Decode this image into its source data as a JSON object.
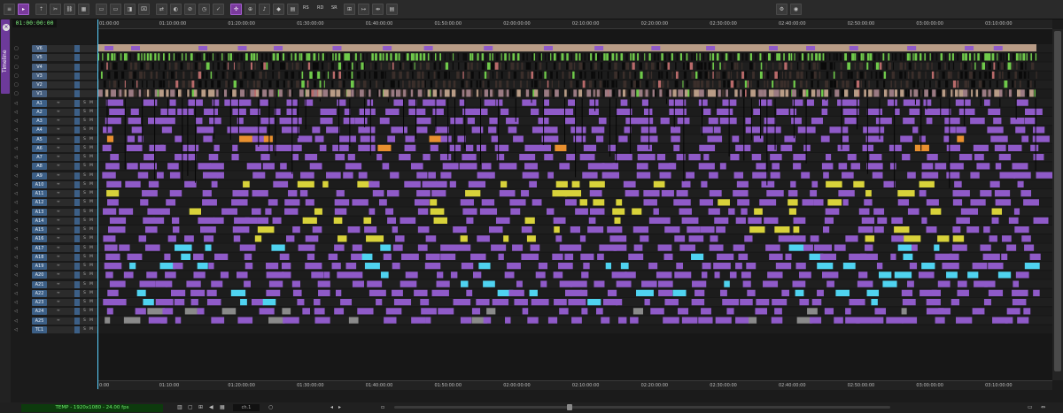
{
  "app": {
    "tab_label": "Timeline",
    "close_glyph": "×",
    "timecode": "01:00:00:00"
  },
  "toolbar": {
    "buttons": [
      {
        "id": "menu",
        "icon": "menu-icon",
        "glyph": "≡"
      },
      {
        "id": "segment-select",
        "icon": "segment-select-icon",
        "glyph": "▸",
        "active": true
      },
      {
        "id": "lift",
        "icon": "lift-icon",
        "glyph": "⇡"
      },
      {
        "id": "cut",
        "icon": "scissors-icon",
        "glyph": "✂"
      },
      {
        "id": "link",
        "icon": "link-icon",
        "glyph": "⛓"
      },
      {
        "id": "grid",
        "icon": "grid-icon",
        "glyph": "▦"
      },
      {
        "id": "overwrite",
        "icon": "overwrite-icon",
        "glyph": "▭"
      },
      {
        "id": "splice",
        "icon": "splice-icon",
        "glyph": "▭"
      },
      {
        "id": "trim",
        "icon": "trim-icon",
        "glyph": "◨"
      },
      {
        "id": "extract",
        "icon": "extract-icon",
        "glyph": "⌧"
      },
      {
        "id": "replace",
        "icon": "replace-icon",
        "glyph": "⇄"
      },
      {
        "id": "effect",
        "icon": "effect-icon",
        "glyph": "◐"
      },
      {
        "id": "no",
        "icon": "disable-icon",
        "glyph": "⊘"
      },
      {
        "id": "clock",
        "icon": "clock-icon",
        "glyph": "◷"
      },
      {
        "id": "check",
        "icon": "check-icon",
        "glyph": "✓"
      },
      {
        "id": "sync",
        "icon": "sync-icon",
        "glyph": "✣",
        "active": true
      },
      {
        "id": "add-edit",
        "icon": "add-edit-icon",
        "glyph": "⊕"
      },
      {
        "id": "audio",
        "icon": "audio-icon",
        "glyph": "♪"
      },
      {
        "id": "keyframe",
        "icon": "keyframe-icon",
        "glyph": "◆"
      },
      {
        "id": "mute",
        "icon": "mute-icon",
        "glyph": "▤"
      }
    ],
    "text_buttons": [
      "RS",
      "RD",
      "SR"
    ],
    "more_buttons": [
      {
        "id": "fx1",
        "icon": "effect-mode-icon",
        "glyph": "⊞"
      },
      {
        "id": "fx2",
        "icon": "trim-mode-icon",
        "glyph": "↦"
      },
      {
        "id": "fx3",
        "icon": "split-icon",
        "glyph": "⇹"
      },
      {
        "id": "fx4",
        "icon": "render-icon",
        "glyph": "▤"
      }
    ],
    "right_buttons": [
      {
        "id": "settings",
        "icon": "gear-icon",
        "glyph": "⚙"
      },
      {
        "id": "status",
        "icon": "status-icon",
        "glyph": "◉"
      }
    ]
  },
  "ruler": {
    "ticks": [
      "01:00:00",
      "01:10:00:00",
      "01:20:00:00",
      "01:30:00:00",
      "01:40:00:00",
      "01:50:00:00",
      "02:00:00:00",
      "02:10:00:00",
      "02:20:00:00",
      "02:30:00:00",
      "02:40:00:00",
      "02:50:00:00",
      "03:00:00:00",
      "03:10:00:00"
    ],
    "bottom_ticks": [
      "0:00",
      "01:10:00",
      "01:20:00:00",
      "01:30:00:00",
      "01:40:00:00",
      "01:50:00:00",
      "02:00:00:00",
      "02:10:00:00",
      "02:20:00:00",
      "02:30:00:00",
      "02:40:00:00",
      "02:50:00:00",
      "03:00:00:00",
      "03:10:00:00"
    ]
  },
  "tracks": [
    {
      "name": "V6",
      "kind": "video"
    },
    {
      "name": "V5",
      "kind": "video"
    },
    {
      "name": "V4",
      "kind": "video"
    },
    {
      "name": "V3",
      "kind": "video"
    },
    {
      "name": "V2",
      "kind": "video"
    },
    {
      "name": "V1",
      "kind": "video"
    },
    {
      "name": "A1",
      "kind": "audio"
    },
    {
      "name": "A2",
      "kind": "audio"
    },
    {
      "name": "A3",
      "kind": "audio"
    },
    {
      "name": "A4",
      "kind": "audio"
    },
    {
      "name": "A5",
      "kind": "audio"
    },
    {
      "name": "A6",
      "kind": "audio"
    },
    {
      "name": "A7",
      "kind": "audio"
    },
    {
      "name": "A8",
      "kind": "audio"
    },
    {
      "name": "A9",
      "kind": "audio"
    },
    {
      "name": "A10",
      "kind": "audio"
    },
    {
      "name": "A11",
      "kind": "audio"
    },
    {
      "name": "A12",
      "kind": "audio"
    },
    {
      "name": "A13",
      "kind": "audio"
    },
    {
      "name": "A14",
      "kind": "audio"
    },
    {
      "name": "A15",
      "kind": "audio"
    },
    {
      "name": "A16",
      "kind": "audio"
    },
    {
      "name": "A17",
      "kind": "audio"
    },
    {
      "name": "A18",
      "kind": "audio"
    },
    {
      "name": "A19",
      "kind": "audio"
    },
    {
      "name": "A20",
      "kind": "audio"
    },
    {
      "name": "A21",
      "kind": "audio"
    },
    {
      "name": "A22",
      "kind": "audio"
    },
    {
      "name": "A23",
      "kind": "audio"
    },
    {
      "name": "A24",
      "kind": "audio"
    },
    {
      "name": "A25",
      "kind": "audio"
    },
    {
      "name": "TC1",
      "kind": "timecode"
    }
  ],
  "track_controls": {
    "solo": "S",
    "mute": "M",
    "waveform": "≈"
  },
  "status": {
    "sequence_info": "TEMP - 1920x1080 - 24.00 fps",
    "zoom_value": "ch.1"
  },
  "colors": {
    "accent": "#7a3a9c",
    "timecode_green": "#7ef07e",
    "track_blue": "#3c5f86",
    "clip_purple": "#8f5ac8",
    "clip_yellow": "#d8d23a",
    "clip_cyan": "#4fd3f0",
    "clip_green": "#6fc94a",
    "clip_tan": "#b89c86",
    "clip_orange": "#e8902f",
    "clip_gray": "#8a8a8a"
  }
}
